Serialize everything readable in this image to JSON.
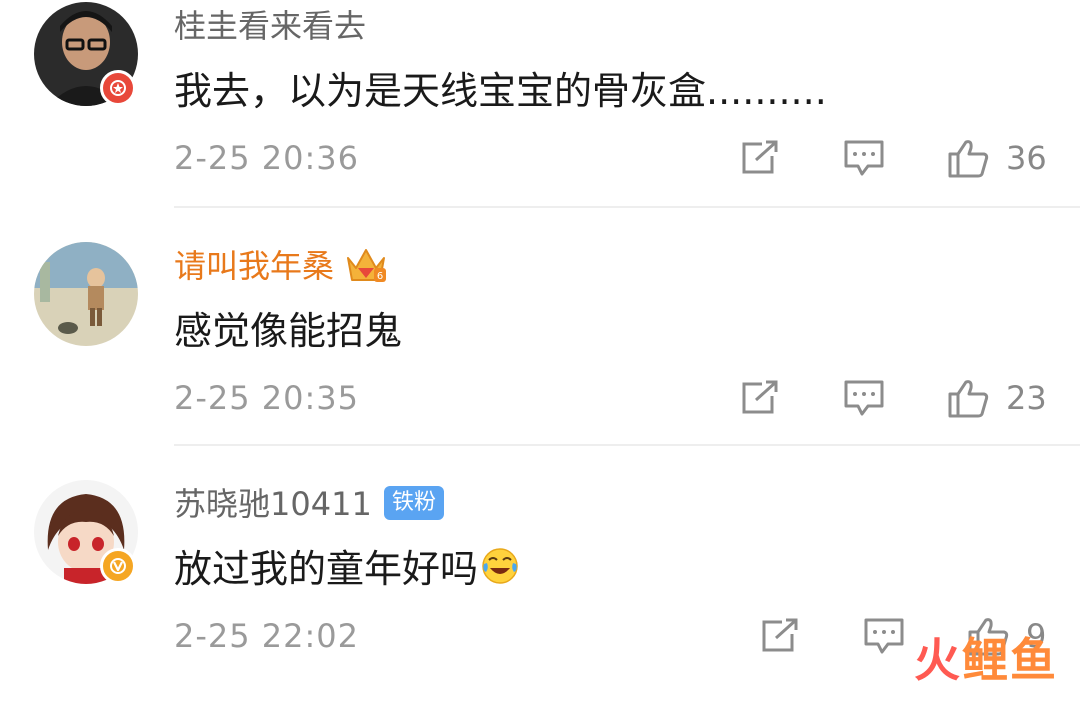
{
  "comments": [
    {
      "username": "桂圭看来看去",
      "text": "我去，以为是天线宝宝的骨灰盒..........",
      "time": "2-25 20:36",
      "likes": "36",
      "avatar_badge": "weibo-red-badge"
    },
    {
      "username": "请叫我年桑",
      "text": "感觉像能招鬼",
      "time": "2-25 20:35",
      "likes": "23",
      "username_color": "#e8791b",
      "user_badge": "vip-crown-icon"
    },
    {
      "username": "苏晓驰10411",
      "fan_badge": "铁粉",
      "text": "放过我的童年好吗",
      "time": "2-25 22:02",
      "likes": "9",
      "avatar_badge": "verified-yellow-badge"
    }
  ],
  "icons": {
    "share": "share-edit-icon",
    "reply": "comment-reply-icon",
    "like": "thumbs-up-icon"
  },
  "watermark": {
    "part1": "火",
    "part2": "鲤鱼"
  }
}
